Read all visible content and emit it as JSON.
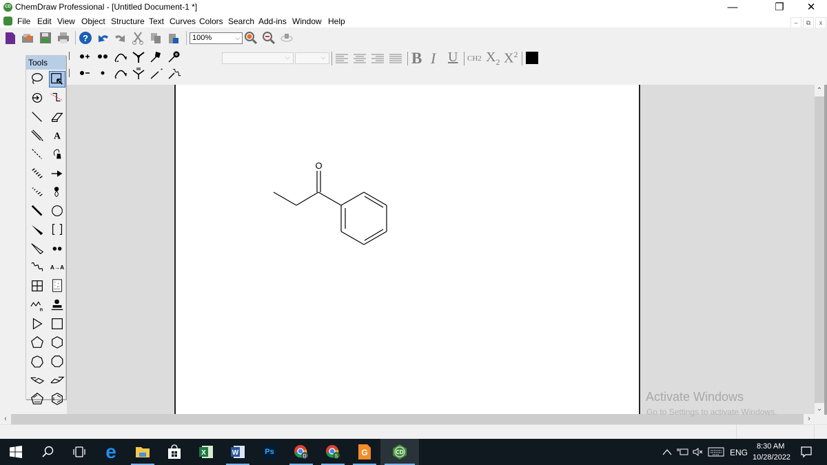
{
  "window": {
    "title": "ChemDraw Professional - [Untitled Document-1 *]",
    "controls": {
      "minimize": "—",
      "restore": "❐",
      "close": "✕"
    },
    "mdi_controls": {
      "minimize": "–",
      "restore": "⧉",
      "close": "x"
    }
  },
  "menu": [
    "File",
    "Edit",
    "View",
    "Object",
    "Structure",
    "Text",
    "Curves",
    "Colors",
    "Search",
    "Add-ins",
    "Window",
    "Help"
  ],
  "toolbar": {
    "icons": [
      "new-document-icon",
      "open-icon",
      "save-icon",
      "print-icon",
      "help-icon",
      "undo-icon",
      "redo-icon",
      "cut-icon",
      "copy-icon",
      "paste-icon",
      "zoom-in-icon",
      "zoom-out-icon",
      "rotate-3d-icon"
    ],
    "zoom_value": "100%"
  },
  "format_toolbar": {
    "font_value": "",
    "size_value": "",
    "bold": "B",
    "italic": "I",
    "underline": "U",
    "formula": "CH2",
    "subscript": "X2",
    "superscript": "X2",
    "color": "#000000"
  },
  "tools_palette": {
    "title": "Tools",
    "tools": [
      [
        "lasso",
        "marquee"
      ],
      [
        "structure-perspective",
        "chain"
      ],
      [
        "solid-bond",
        "eraser"
      ],
      [
        "multiple-bond",
        "text"
      ],
      [
        "dashed-bond",
        "pen"
      ],
      [
        "hashed-bond",
        "arrow"
      ],
      [
        "hashed-wedge-bond",
        "orbital"
      ],
      [
        "bold-bond",
        "drawing-elements"
      ],
      [
        "wedge-bond",
        "brackets"
      ],
      [
        "hollow-wedge-bond",
        "chemical-symbols"
      ],
      [
        "wavy-bond",
        "query"
      ],
      [
        "table",
        "tlc-plate"
      ],
      [
        "polymer",
        "templates"
      ],
      [
        "triangle",
        "rectangle"
      ],
      [
        "cyclopentane",
        "cyclohexane"
      ],
      [
        "cycloheptane",
        "cyclooctane"
      ],
      [
        "chair-1",
        "chair-2"
      ],
      [
        "cyclopentadiene",
        "benzene"
      ]
    ]
  },
  "chem_toolbar": {
    "row1": [
      "radical-cation",
      "diradical",
      "curved-arrow-double",
      "lone-pair-y",
      "attachment-point-1",
      "attachment-point-2"
    ],
    "row2": [
      "radical-anion",
      "radical",
      "curved-arrow",
      "lone-pair-y-alt",
      "wedge-attach",
      "wavy-attach"
    ]
  },
  "document": {
    "molecule": {
      "name": "propiophenone",
      "atom_labels": [
        {
          "symbol": "O"
        }
      ]
    }
  },
  "watermark": {
    "line1": "Activate Windows",
    "line2": "Go to Settings to activate Windows."
  },
  "taskbar": {
    "apps": [
      "start",
      "search",
      "task-view",
      "edge",
      "file-explorer",
      "store",
      "excel",
      "word",
      "photoshop",
      "chrome-d",
      "chrome-s",
      "foxit-pdf",
      "chemdraw"
    ],
    "ps_label": "Ps",
    "tray": {
      "language": "ENG",
      "time": "8:30 AM",
      "date": "10/28/2022"
    }
  }
}
